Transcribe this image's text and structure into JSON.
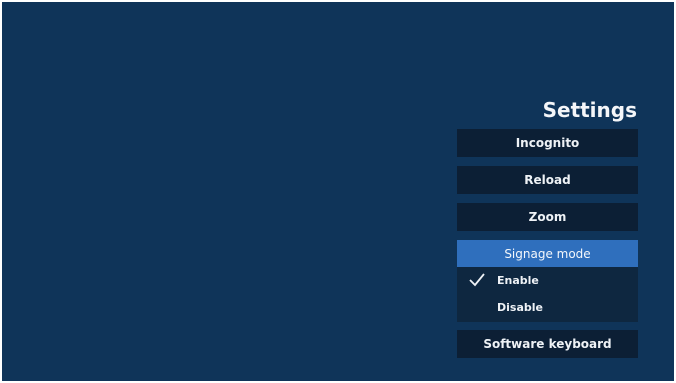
{
  "settings": {
    "title": "Settings",
    "buttons": {
      "incognito": "Incognito",
      "reload": "Reload",
      "zoom": "Zoom",
      "signage_mode": "Signage mode",
      "software_keyboard": "Software keyboard"
    },
    "signage_options": {
      "enable": "Enable",
      "disable": "Disable",
      "selected": "Enable"
    },
    "selected_item": "Signage mode"
  },
  "icons": {
    "check": "checkmark-icon"
  },
  "colors": {
    "background": "#0f3459",
    "button_bg": "#0c1f35",
    "selected_bg": "#2f6fbd",
    "submenu_bg": "#0e2740",
    "text": "#eef2f6"
  }
}
